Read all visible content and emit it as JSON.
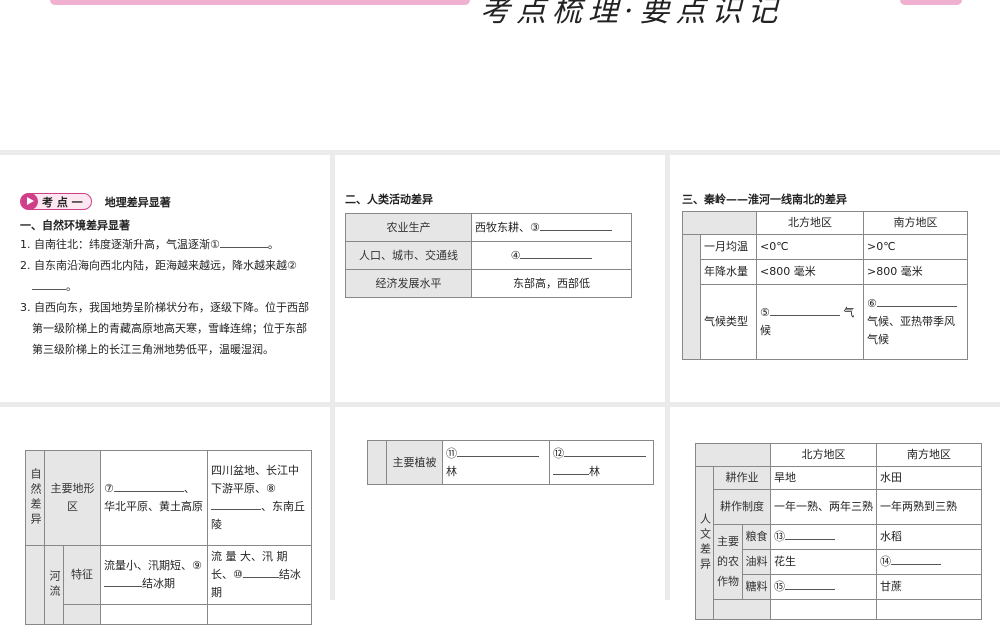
{
  "banner": {
    "title": "考点梳理·要点识记"
  },
  "p1": {
    "badge": "考 点 一",
    "badge_title": "地理差异显著",
    "section": "一、自然环境差异显著",
    "items": [
      "1. 自南往北：纬度逐渐升高，气温逐渐①",
      "。",
      "2. 自东南沿海向西北内陆，距海越来越远，降水越来越②",
      "。",
      "3. 自西向东，我国地势呈阶梯状分布，逐级下降。位于西部第一级阶梯上的青藏高原地高天寒，雪峰连绵；位于东部第三级阶梯上的长江三角洲地势低平，温暖湿润。"
    ]
  },
  "p2": {
    "section": "二、人类活动差异",
    "rows": [
      [
        "农业生产",
        "西牧东耕、③"
      ],
      [
        "人口、城市、交通线",
        "④"
      ],
      [
        "经济发展水平",
        "东部高，西部低"
      ]
    ]
  },
  "p3": {
    "section": "三、秦岭——淮河一线南北的差异",
    "header": [
      "北方地区",
      "南方地区"
    ],
    "rows": [
      [
        "一月均温",
        "<0℃",
        ">0℃"
      ],
      [
        "年降水量",
        "<800 毫米",
        ">800 毫米"
      ],
      [
        "气候类型",
        "⑤",
        "气候",
        "⑥",
        "气候、亚热带季风气候"
      ]
    ]
  },
  "p4": {
    "group": "自然差异",
    "landform": "主要地形区",
    "north": [
      "⑦",
      "、华北平原、黄土高原"
    ],
    "south": [
      "四川盆地、长江中下游平原、⑧",
      "、东南丘陵"
    ],
    "river": "河流",
    "feature": "特征",
    "river_north": [
      "流量小、汛期短、⑨",
      "结冰期"
    ],
    "river_south": [
      "流 量 大、汛 期 长、⑩",
      "结冰期"
    ]
  },
  "p5": {
    "label": "主要植被",
    "north": [
      "⑪",
      "林"
    ],
    "south": [
      "⑫",
      "林"
    ]
  },
  "p6": {
    "header": [
      "北方地区",
      "南方地区"
    ],
    "group": "人文差异",
    "crops": "主要的农作物",
    "rows": [
      [
        "耕作业",
        "旱地",
        "水田"
      ],
      [
        "耕作制度",
        "一年一熟、两年三熟",
        "一年两熟到三熟"
      ],
      [
        "粮食",
        "⑬",
        "水稻"
      ],
      [
        "油料",
        "花生",
        "⑭"
      ],
      [
        "糖料",
        "⑮",
        "甘蔗"
      ]
    ]
  }
}
